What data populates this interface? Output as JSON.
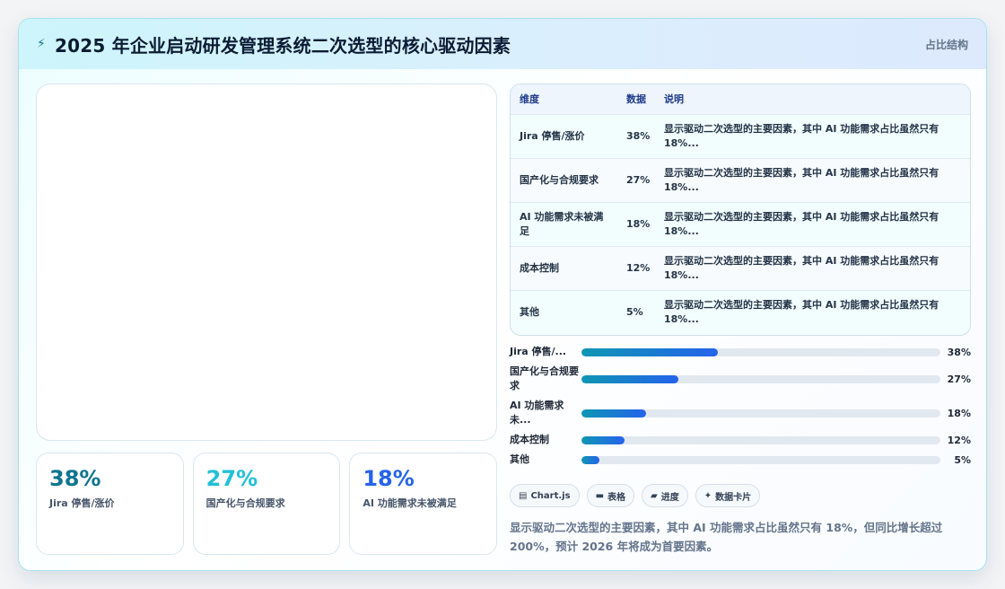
{
  "header": {
    "title": "2025 年企业启动研发管理系统二次选型的核心驱动因素",
    "tag": "占比结构",
    "icon": "lightning-icon"
  },
  "stats": [
    {
      "value": "38%",
      "label": "Jira 停售/涨价",
      "color": "#0e7490"
    },
    {
      "value": "27%",
      "label": "国产化与合规要求",
      "color": "#22c0d9"
    },
    {
      "value": "18%",
      "label": "AI 功能需求未被满足",
      "color": "#2563eb"
    }
  ],
  "table": {
    "headers": [
      "维度",
      "数据",
      "说明"
    ],
    "rows": [
      {
        "dim": "Jira 停售/涨价",
        "value": "38%",
        "desc": "显示驱动二次选型的主要因素，其中 AI 功能需求占比虽然只有 18%..."
      },
      {
        "dim": "国产化与合规要求",
        "value": "27%",
        "desc": "显示驱动二次选型的主要因素，其中 AI 功能需求占比虽然只有 18%..."
      },
      {
        "dim": "AI 功能需求未被满足",
        "value": "18%",
        "desc": "显示驱动二次选型的主要因素，其中 AI 功能需求占比虽然只有 18%..."
      },
      {
        "dim": "成本控制",
        "value": "12%",
        "desc": "显示驱动二次选型的主要因素，其中 AI 功能需求占比虽然只有 18%..."
      },
      {
        "dim": "其他",
        "value": "5%",
        "desc": "显示驱动二次选型的主要因素，其中 AI 功能需求占比虽然只有 18%..."
      }
    ]
  },
  "bars": [
    {
      "label": "Jira 停售/...",
      "percent": 38,
      "pct_label": "38%"
    },
    {
      "label": "国产化与合规要求",
      "percent": 27,
      "pct_label": "27%"
    },
    {
      "label": "AI 功能需求未...",
      "percent": 18,
      "pct_label": "18%"
    },
    {
      "label": "成本控制",
      "percent": 12,
      "pct_label": "12%"
    },
    {
      "label": "其他",
      "percent": 5,
      "pct_label": "5%"
    }
  ],
  "toolbar": {
    "chartjs": "Chart.js",
    "table": "表格",
    "progress": "进度",
    "cards": "数据卡片"
  },
  "summary": "显示驱动二次选型的主要因素，其中 AI 功能需求占比虽然只有 18%，但同比增长超过 200%，预计 2026 年将成为首要因素。"
}
